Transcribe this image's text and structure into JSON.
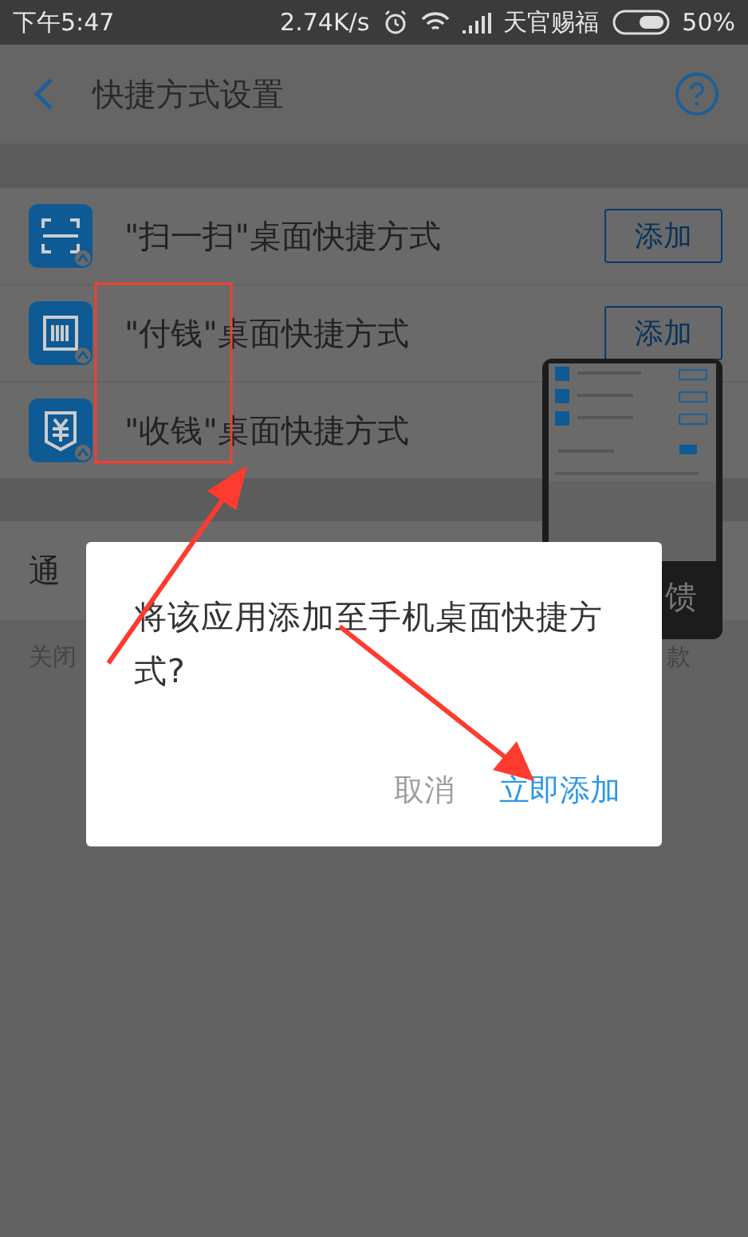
{
  "status_bar": {
    "time": "下午5:47",
    "net_speed": "2.74K/s",
    "carrier": "天官赐福",
    "battery": "50%"
  },
  "header": {
    "title": "快捷方式设置"
  },
  "shortcuts": [
    {
      "label": "\"扫一扫\"桌面快捷方式",
      "button": "添加"
    },
    {
      "label": "\"付钱\"桌面快捷方式",
      "button": "添加"
    },
    {
      "label": "\"收钱\"桌面快捷方式"
    }
  ],
  "notify": {
    "title": "通",
    "desc_start": "关闭",
    "desc_end": "款"
  },
  "thumbnail": {
    "caption": "馈"
  },
  "dialog": {
    "message": "将该应用添加至手机桌面快捷方式?",
    "buttons": [
      {
        "label": "取消",
        "kind": "cancel"
      },
      {
        "label": "立即添加",
        "kind": "confirm"
      }
    ]
  }
}
